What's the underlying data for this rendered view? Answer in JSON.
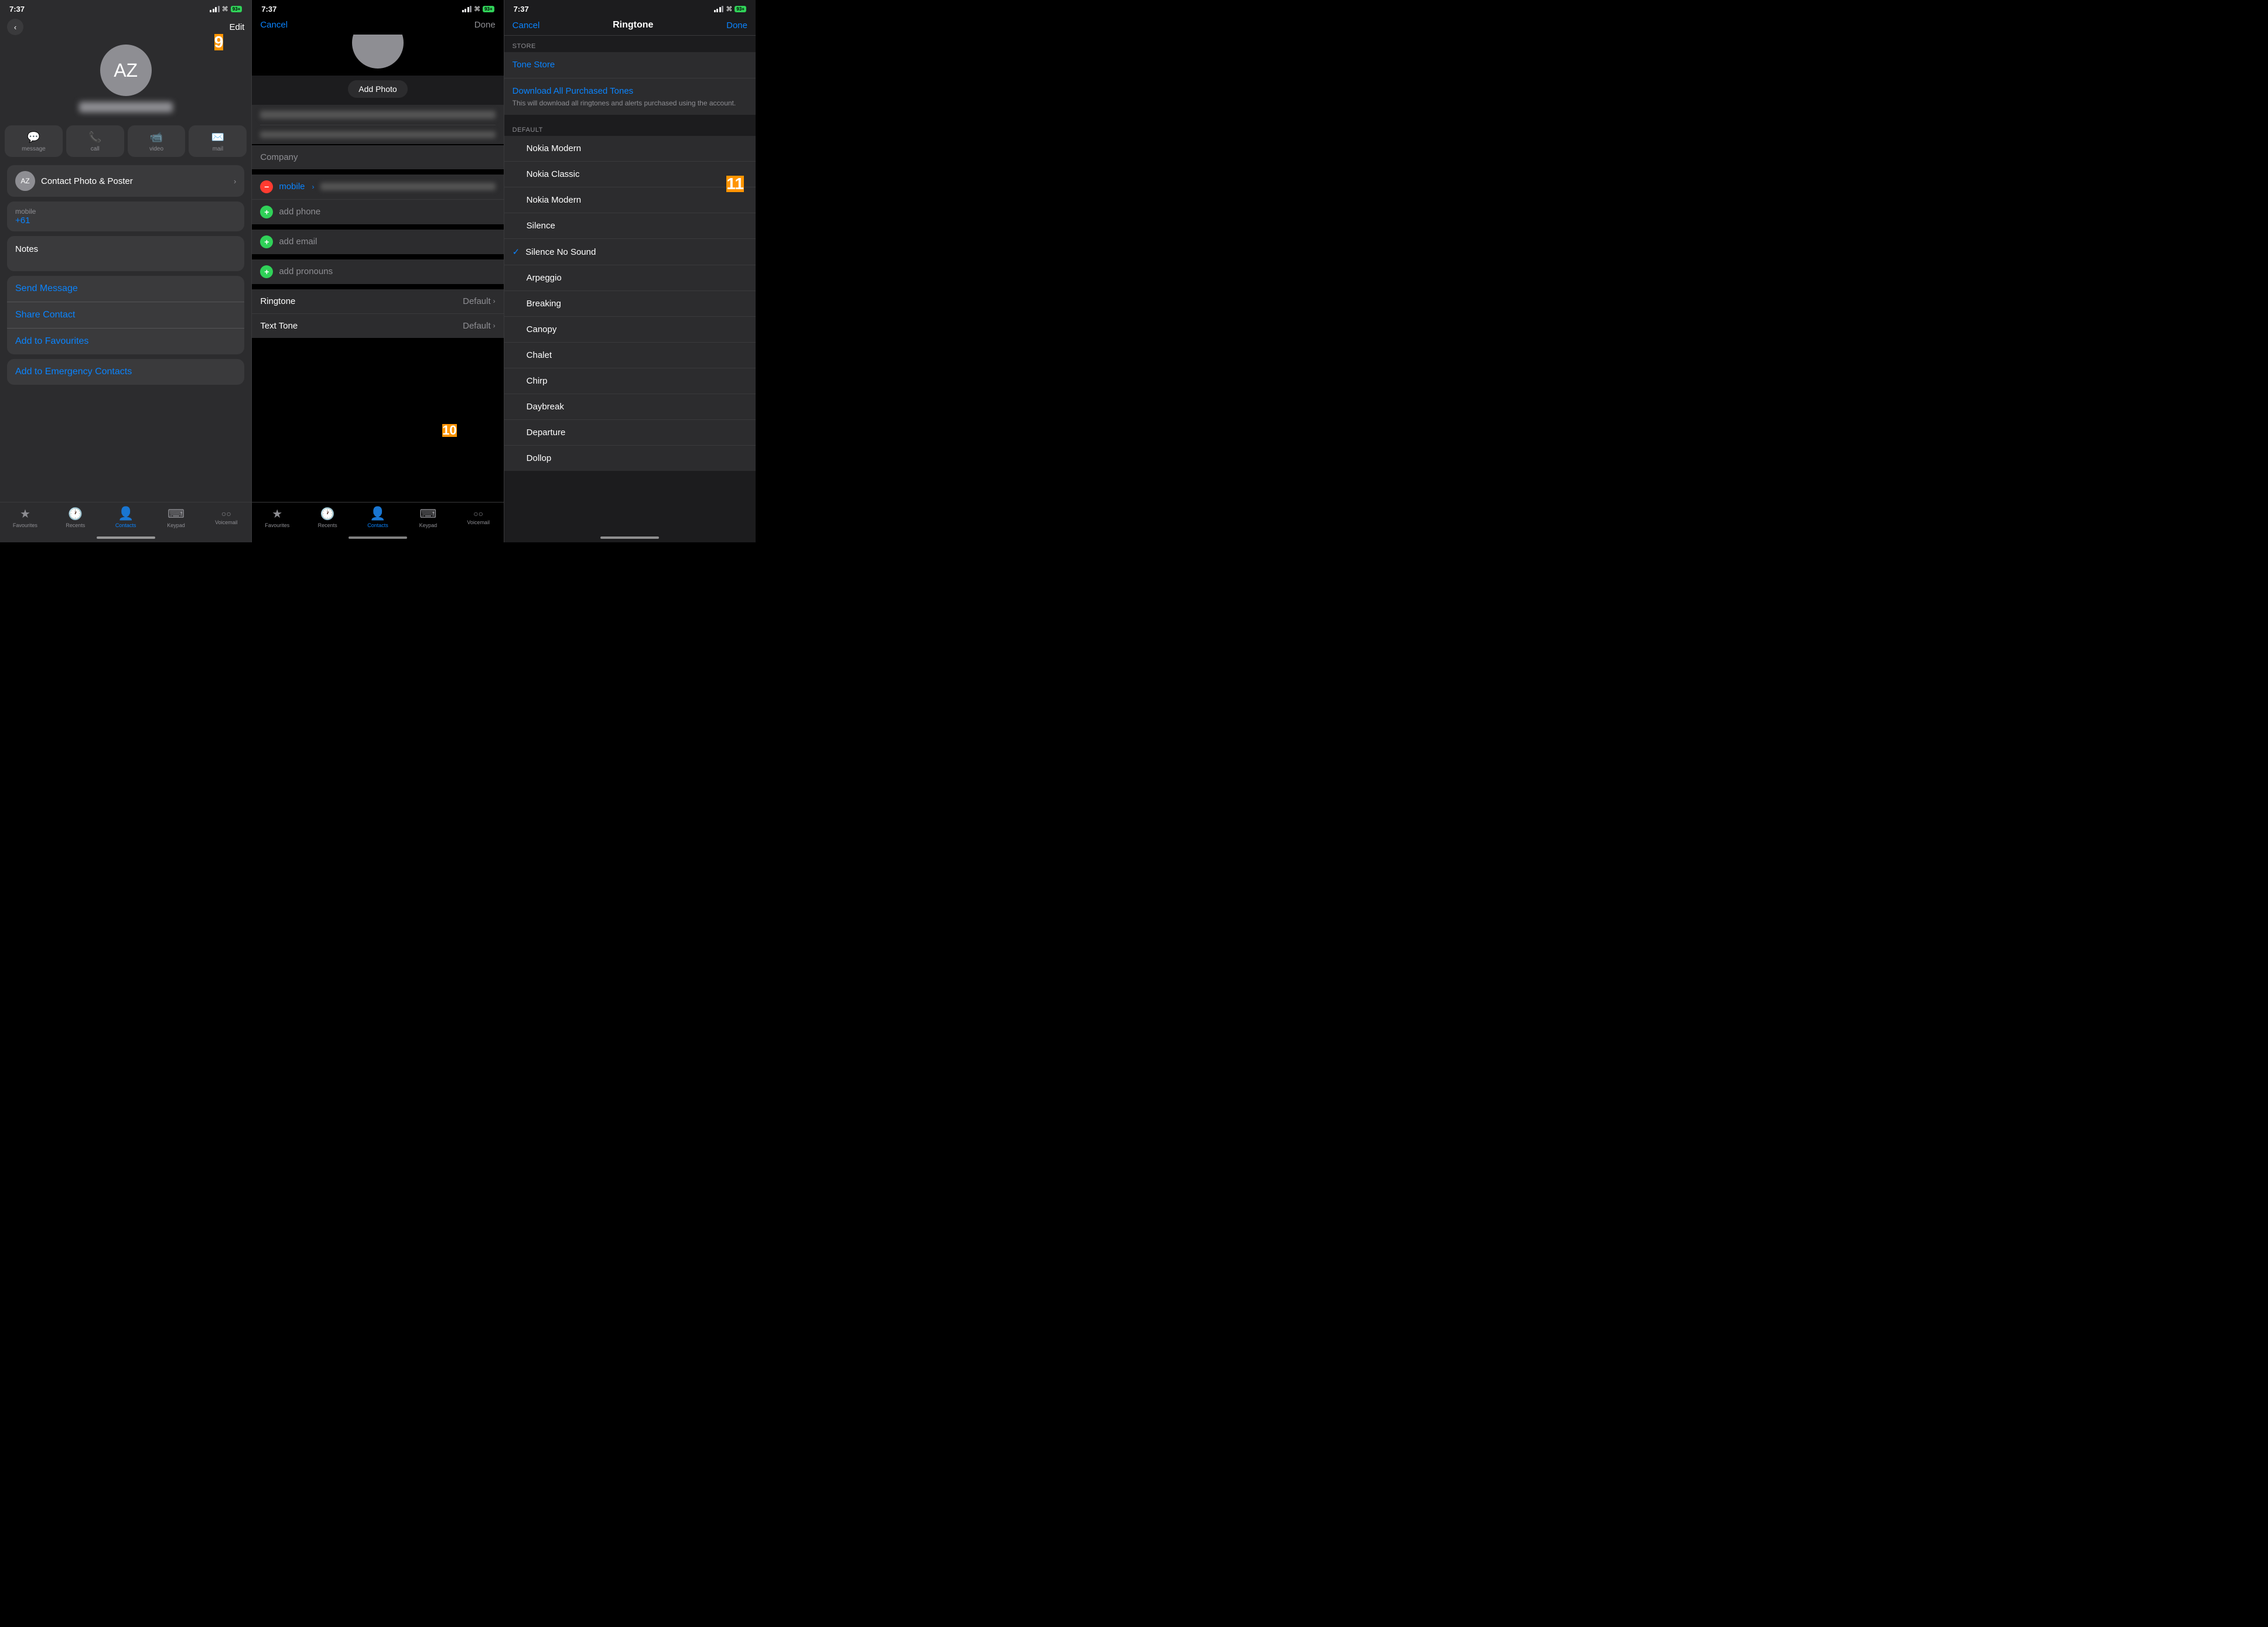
{
  "panel1": {
    "statusBar": {
      "time": "7:37",
      "battery": "93+"
    },
    "backButton": "‹",
    "editButton": "Edit",
    "notificationBadge": "9",
    "avatar": {
      "initials": "AZ"
    },
    "actionButtons": [
      {
        "icon": "💬",
        "label": "message"
      },
      {
        "icon": "📞",
        "label": "call"
      },
      {
        "icon": "📹",
        "label": "video"
      },
      {
        "icon": "✉️",
        "label": "mail"
      }
    ],
    "contactPhotoLabel": "Contact Photo & Poster",
    "mobileSection": {
      "label": "mobile",
      "value": "+61"
    },
    "notesLabel": "Notes",
    "actions": {
      "sendMessage": "Send Message",
      "shareContact": "Share Contact",
      "addToFavourites": "Add to Favourites"
    },
    "emergencyLabel": "Add to Emergency Contacts",
    "tabBar": {
      "items": [
        {
          "icon": "★",
          "label": "Favourites"
        },
        {
          "icon": "🕐",
          "label": "Recents"
        },
        {
          "icon": "👤",
          "label": "Contacts",
          "active": true
        },
        {
          "icon": "⌨",
          "label": "Keypad"
        },
        {
          "icon": "○○",
          "label": "Voicemail"
        }
      ]
    }
  },
  "panel2": {
    "statusBar": {
      "time": "7:37",
      "battery": "93+"
    },
    "cancelLabel": "Cancel",
    "doneLabel": "Done",
    "addPhotoLabel": "Add Photo",
    "companyPlaceholder": "Company",
    "phoneMobileLabel": "mobile",
    "addPhoneLabel": "add phone",
    "addEmailLabel": "add email",
    "addPronounsLabel": "add pronouns",
    "ringtoneRow": {
      "label": "Ringtone",
      "value": "Default"
    },
    "textToneRow": {
      "label": "Text Tone",
      "value": "Default"
    },
    "notificationBadge": "10",
    "tabBar": {
      "items": [
        {
          "icon": "★",
          "label": "Favourites"
        },
        {
          "icon": "🕐",
          "label": "Recents"
        },
        {
          "icon": "👤",
          "label": "Contacts",
          "active": true
        },
        {
          "icon": "⌨",
          "label": "Keypad"
        },
        {
          "icon": "○○",
          "label": "Voicemail"
        }
      ]
    }
  },
  "panel3": {
    "statusBar": {
      "time": "7:37",
      "battery": "93+"
    },
    "cancelLabel": "Cancel",
    "title": "Ringtone",
    "doneLabel": "Done",
    "storeSectionHeader": "STORE",
    "toneStoreLabel": "Tone Store",
    "downloadAllLabel": "Download All Purchased Tones",
    "downloadAllSubtext": "This will download all ringtones and alerts purchased using the account.",
    "defaultSectionHeader": "DEFAULT",
    "ringtones": [
      {
        "name": "Nokia Modern",
        "selected": false
      },
      {
        "name": "Nokia Classic",
        "selected": false
      },
      {
        "name": "Nokia Modern",
        "selected": false
      },
      {
        "name": "Silence",
        "selected": false
      },
      {
        "name": "Silence No Sound",
        "selected": true
      },
      {
        "name": "Arpeggio",
        "selected": false
      },
      {
        "name": "Breaking",
        "selected": false
      },
      {
        "name": "Canopy",
        "selected": false
      },
      {
        "name": "Chalet",
        "selected": false
      },
      {
        "name": "Chirp",
        "selected": false
      },
      {
        "name": "Daybreak",
        "selected": false
      },
      {
        "name": "Departure",
        "selected": false
      },
      {
        "name": "Dollop",
        "selected": false
      }
    ],
    "notificationBadge": "11"
  }
}
